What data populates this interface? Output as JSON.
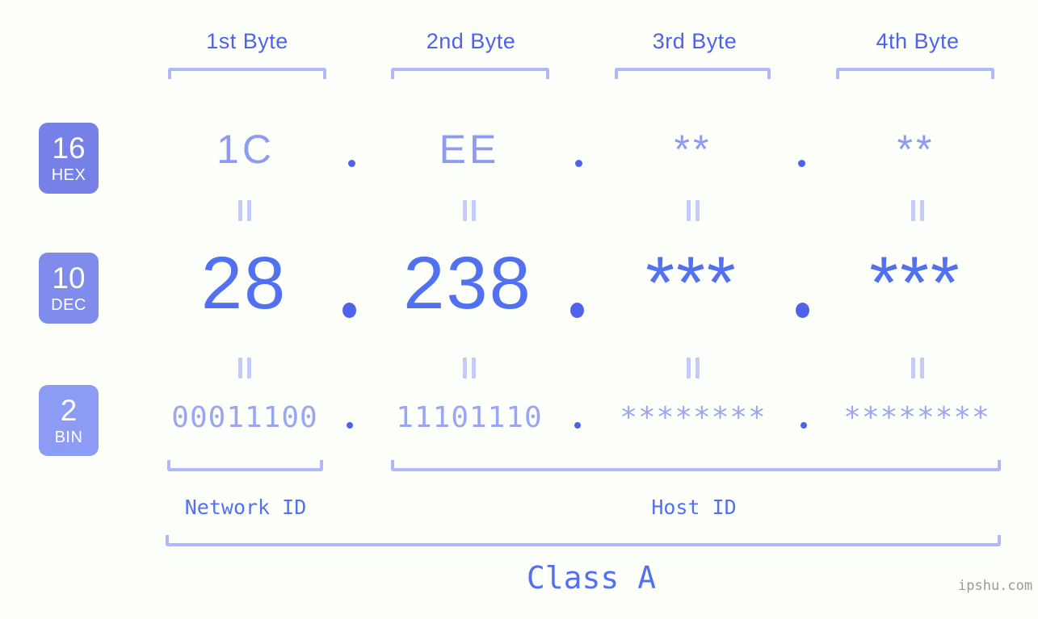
{
  "site": {
    "watermark": "ipshu.com"
  },
  "headers": [
    {
      "label": "1st Byte"
    },
    {
      "label": "2nd Byte"
    },
    {
      "label": "3rd Byte"
    },
    {
      "label": "4th Byte"
    }
  ],
  "rows": [
    {
      "badge_num": "16",
      "badge_name": "HEX",
      "badge_color": "#7681e8",
      "values": [
        "1C",
        "EE",
        "**",
        "**"
      ],
      "separator": "."
    },
    {
      "badge_num": "10",
      "badge_name": "DEC",
      "badge_color": "#7f8cec",
      "values": [
        "28",
        "238",
        "***",
        "***"
      ],
      "separator": "."
    },
    {
      "badge_num": "2",
      "badge_name": "BIN",
      "badge_color": "#8c9cf5",
      "values": [
        "00011100",
        "11101110",
        "********",
        "********"
      ],
      "separator": "."
    }
  ],
  "equals_symbol": "||",
  "sections": [
    {
      "label": "Network ID"
    },
    {
      "label": "Host ID"
    }
  ],
  "class": {
    "label": "Class A"
  },
  "colors": {
    "background": "#fdfffa",
    "accent": "#5271f0",
    "accent_light": "#aeb8fb",
    "hex_text": "#8e9bf0",
    "bin_text": "#9aa6f2",
    "watermark_text": "#9a9a9a"
  }
}
